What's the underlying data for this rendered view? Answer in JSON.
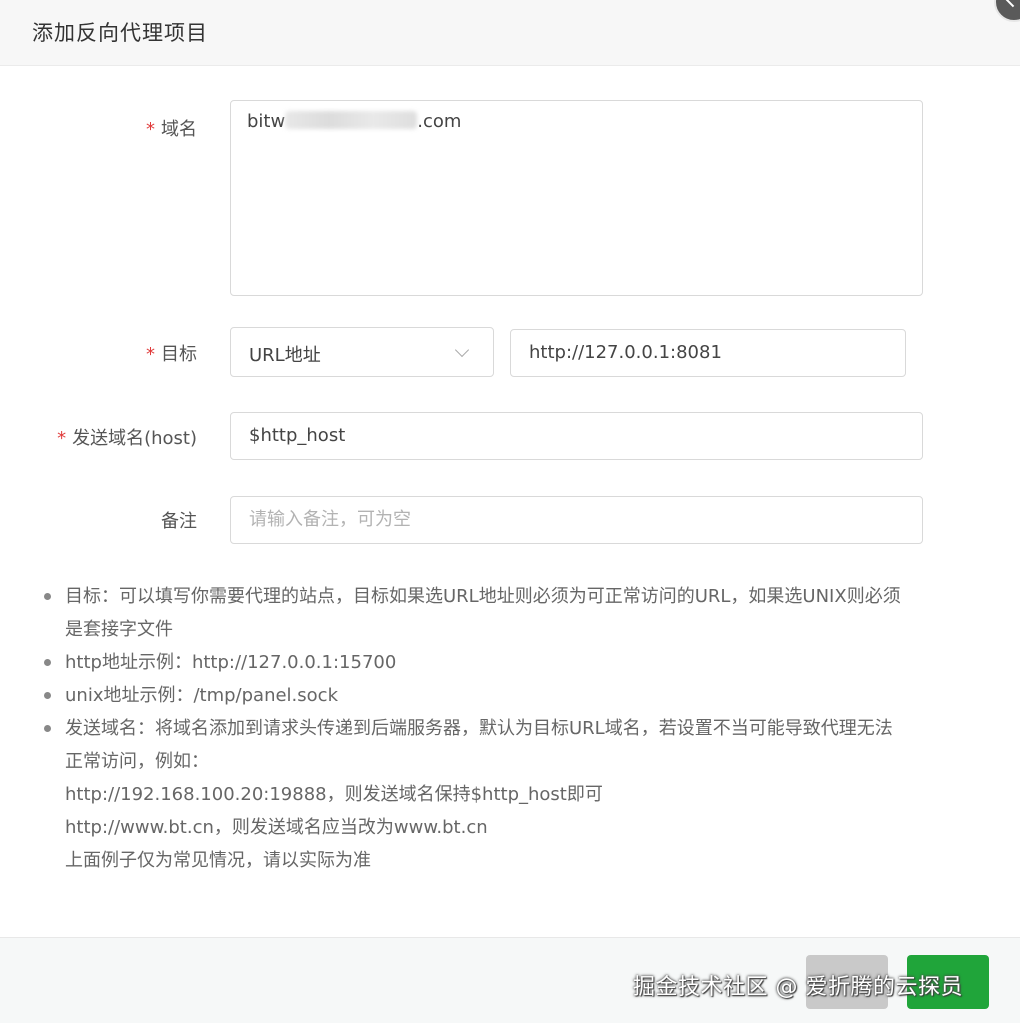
{
  "dialog": {
    "title": "添加反向代理项目"
  },
  "form": {
    "domain": {
      "required_mark": "*",
      "label": "域名",
      "value_prefix": "bitw",
      "value_suffix": ".com"
    },
    "target": {
      "required_mark": "*",
      "label": "目标",
      "select_value": "URL地址",
      "url_value": "http://127.0.0.1:8081"
    },
    "host": {
      "required_mark": "*",
      "label": "发送域名(host)",
      "value": "$http_host"
    },
    "remark": {
      "label": "备注",
      "placeholder": "请输入备注，可为空"
    }
  },
  "tips": [
    "目标：可以填写你需要代理的站点，目标如果选URL地址则必须为可正常访问的URL，如果选UNIX则必须",
    "是套接字文件",
    "http地址示例：http://127.0.0.1:15700",
    "unix地址示例：/tmp/panel.sock",
    "发送域名：将域名添加到请求头传递到后端服务器，默认为目标URL域名，若设置不当可能导致代理无法",
    "正常访问，例如：",
    "http://192.168.100.20:19888，则发送域名保持$http_host即可",
    "http://www.bt.cn，则发送域名应当改为www.bt.cn",
    "上面例子仅为常见情况，请以实际为准"
  ],
  "footer": {
    "watermark": "掘金技术社区 @ 爱折腾的云探员"
  },
  "colors": {
    "required": "#e03a3a",
    "confirm": "#20a53a",
    "cancel": "#c9c9c9"
  }
}
